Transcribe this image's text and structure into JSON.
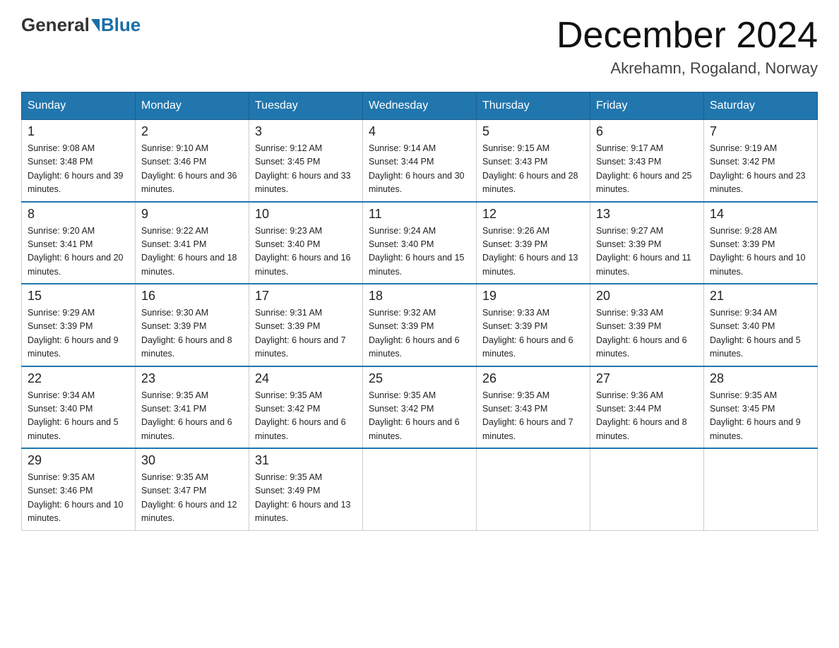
{
  "header": {
    "title": "December 2024",
    "location": "Akrehamn, Rogaland, Norway",
    "logo_general": "General",
    "logo_blue": "Blue"
  },
  "weekdays": [
    "Sunday",
    "Monday",
    "Tuesday",
    "Wednesday",
    "Thursday",
    "Friday",
    "Saturday"
  ],
  "weeks": [
    [
      {
        "day": "1",
        "sunrise": "9:08 AM",
        "sunset": "3:48 PM",
        "daylight": "6 hours and 39 minutes."
      },
      {
        "day": "2",
        "sunrise": "9:10 AM",
        "sunset": "3:46 PM",
        "daylight": "6 hours and 36 minutes."
      },
      {
        "day": "3",
        "sunrise": "9:12 AM",
        "sunset": "3:45 PM",
        "daylight": "6 hours and 33 minutes."
      },
      {
        "day": "4",
        "sunrise": "9:14 AM",
        "sunset": "3:44 PM",
        "daylight": "6 hours and 30 minutes."
      },
      {
        "day": "5",
        "sunrise": "9:15 AM",
        "sunset": "3:43 PM",
        "daylight": "6 hours and 28 minutes."
      },
      {
        "day": "6",
        "sunrise": "9:17 AM",
        "sunset": "3:43 PM",
        "daylight": "6 hours and 25 minutes."
      },
      {
        "day": "7",
        "sunrise": "9:19 AM",
        "sunset": "3:42 PM",
        "daylight": "6 hours and 23 minutes."
      }
    ],
    [
      {
        "day": "8",
        "sunrise": "9:20 AM",
        "sunset": "3:41 PM",
        "daylight": "6 hours and 20 minutes."
      },
      {
        "day": "9",
        "sunrise": "9:22 AM",
        "sunset": "3:41 PM",
        "daylight": "6 hours and 18 minutes."
      },
      {
        "day": "10",
        "sunrise": "9:23 AM",
        "sunset": "3:40 PM",
        "daylight": "6 hours and 16 minutes."
      },
      {
        "day": "11",
        "sunrise": "9:24 AM",
        "sunset": "3:40 PM",
        "daylight": "6 hours and 15 minutes."
      },
      {
        "day": "12",
        "sunrise": "9:26 AM",
        "sunset": "3:39 PM",
        "daylight": "6 hours and 13 minutes."
      },
      {
        "day": "13",
        "sunrise": "9:27 AM",
        "sunset": "3:39 PM",
        "daylight": "6 hours and 11 minutes."
      },
      {
        "day": "14",
        "sunrise": "9:28 AM",
        "sunset": "3:39 PM",
        "daylight": "6 hours and 10 minutes."
      }
    ],
    [
      {
        "day": "15",
        "sunrise": "9:29 AM",
        "sunset": "3:39 PM",
        "daylight": "6 hours and 9 minutes."
      },
      {
        "day": "16",
        "sunrise": "9:30 AM",
        "sunset": "3:39 PM",
        "daylight": "6 hours and 8 minutes."
      },
      {
        "day": "17",
        "sunrise": "9:31 AM",
        "sunset": "3:39 PM",
        "daylight": "6 hours and 7 minutes."
      },
      {
        "day": "18",
        "sunrise": "9:32 AM",
        "sunset": "3:39 PM",
        "daylight": "6 hours and 6 minutes."
      },
      {
        "day": "19",
        "sunrise": "9:33 AM",
        "sunset": "3:39 PM",
        "daylight": "6 hours and 6 minutes."
      },
      {
        "day": "20",
        "sunrise": "9:33 AM",
        "sunset": "3:39 PM",
        "daylight": "6 hours and 6 minutes."
      },
      {
        "day": "21",
        "sunrise": "9:34 AM",
        "sunset": "3:40 PM",
        "daylight": "6 hours and 5 minutes."
      }
    ],
    [
      {
        "day": "22",
        "sunrise": "9:34 AM",
        "sunset": "3:40 PM",
        "daylight": "6 hours and 5 minutes."
      },
      {
        "day": "23",
        "sunrise": "9:35 AM",
        "sunset": "3:41 PM",
        "daylight": "6 hours and 6 minutes."
      },
      {
        "day": "24",
        "sunrise": "9:35 AM",
        "sunset": "3:42 PM",
        "daylight": "6 hours and 6 minutes."
      },
      {
        "day": "25",
        "sunrise": "9:35 AM",
        "sunset": "3:42 PM",
        "daylight": "6 hours and 6 minutes."
      },
      {
        "day": "26",
        "sunrise": "9:35 AM",
        "sunset": "3:43 PM",
        "daylight": "6 hours and 7 minutes."
      },
      {
        "day": "27",
        "sunrise": "9:36 AM",
        "sunset": "3:44 PM",
        "daylight": "6 hours and 8 minutes."
      },
      {
        "day": "28",
        "sunrise": "9:35 AM",
        "sunset": "3:45 PM",
        "daylight": "6 hours and 9 minutes."
      }
    ],
    [
      {
        "day": "29",
        "sunrise": "9:35 AM",
        "sunset": "3:46 PM",
        "daylight": "6 hours and 10 minutes."
      },
      {
        "day": "30",
        "sunrise": "9:35 AM",
        "sunset": "3:47 PM",
        "daylight": "6 hours and 12 minutes."
      },
      {
        "day": "31",
        "sunrise": "9:35 AM",
        "sunset": "3:49 PM",
        "daylight": "6 hours and 13 minutes."
      },
      null,
      null,
      null,
      null
    ]
  ]
}
